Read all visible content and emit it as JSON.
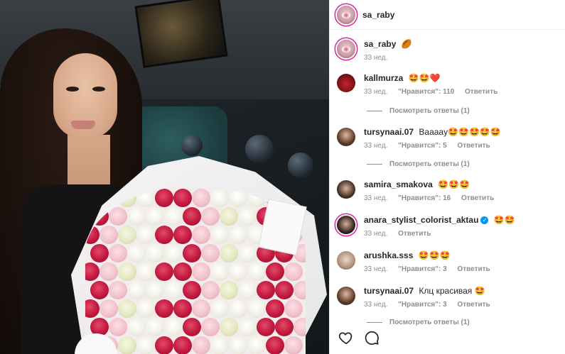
{
  "post": {
    "author": "sa_raby"
  },
  "caption": {
    "username": "sa_raby",
    "text": "🏉",
    "time": "33 нед."
  },
  "labels": {
    "reply": "Ответить",
    "view_replies": "Посмотреть ответы (1)"
  },
  "comments": [
    {
      "username": "kallmurza",
      "text": "🤩🤩❤️",
      "time": "33 нед.",
      "likes": "\"Нравится\": 110",
      "has_reply": true
    },
    {
      "username": "tursynaai.07",
      "text": "Вааааy🤩🤩🤩🤩🤩",
      "time": "33 нед.",
      "likes": "\"Нравится\": 5",
      "has_reply": true
    },
    {
      "username": "samira_smakova",
      "text": "🤩🤩🤩",
      "time": "33 нед.",
      "likes": "\"Нравится\": 16",
      "has_reply": false
    },
    {
      "username": "anara_stylist_colorist_aktau",
      "text": "🤩🤩",
      "time": "33 нед.",
      "likes": "",
      "verified": true,
      "has_reply": false
    },
    {
      "username": "arushka.sss",
      "text": "🤩🤩🤩",
      "time": "33 нед.",
      "likes": "\"Нравится\": 3",
      "has_reply": false
    },
    {
      "username": "tursynaai.07",
      "text": "Клц красивая 🤩",
      "time": "33 нед.",
      "likes": "\"Нравится\": 3",
      "has_reply": true
    }
  ],
  "icons": {
    "like": "heart-icon",
    "comment": "comment-icon",
    "verified": "verified-badge-icon"
  },
  "colors": {
    "story_ring": "#d6249f",
    "verified": "#0095f6",
    "muted": "#8e8e8e"
  }
}
